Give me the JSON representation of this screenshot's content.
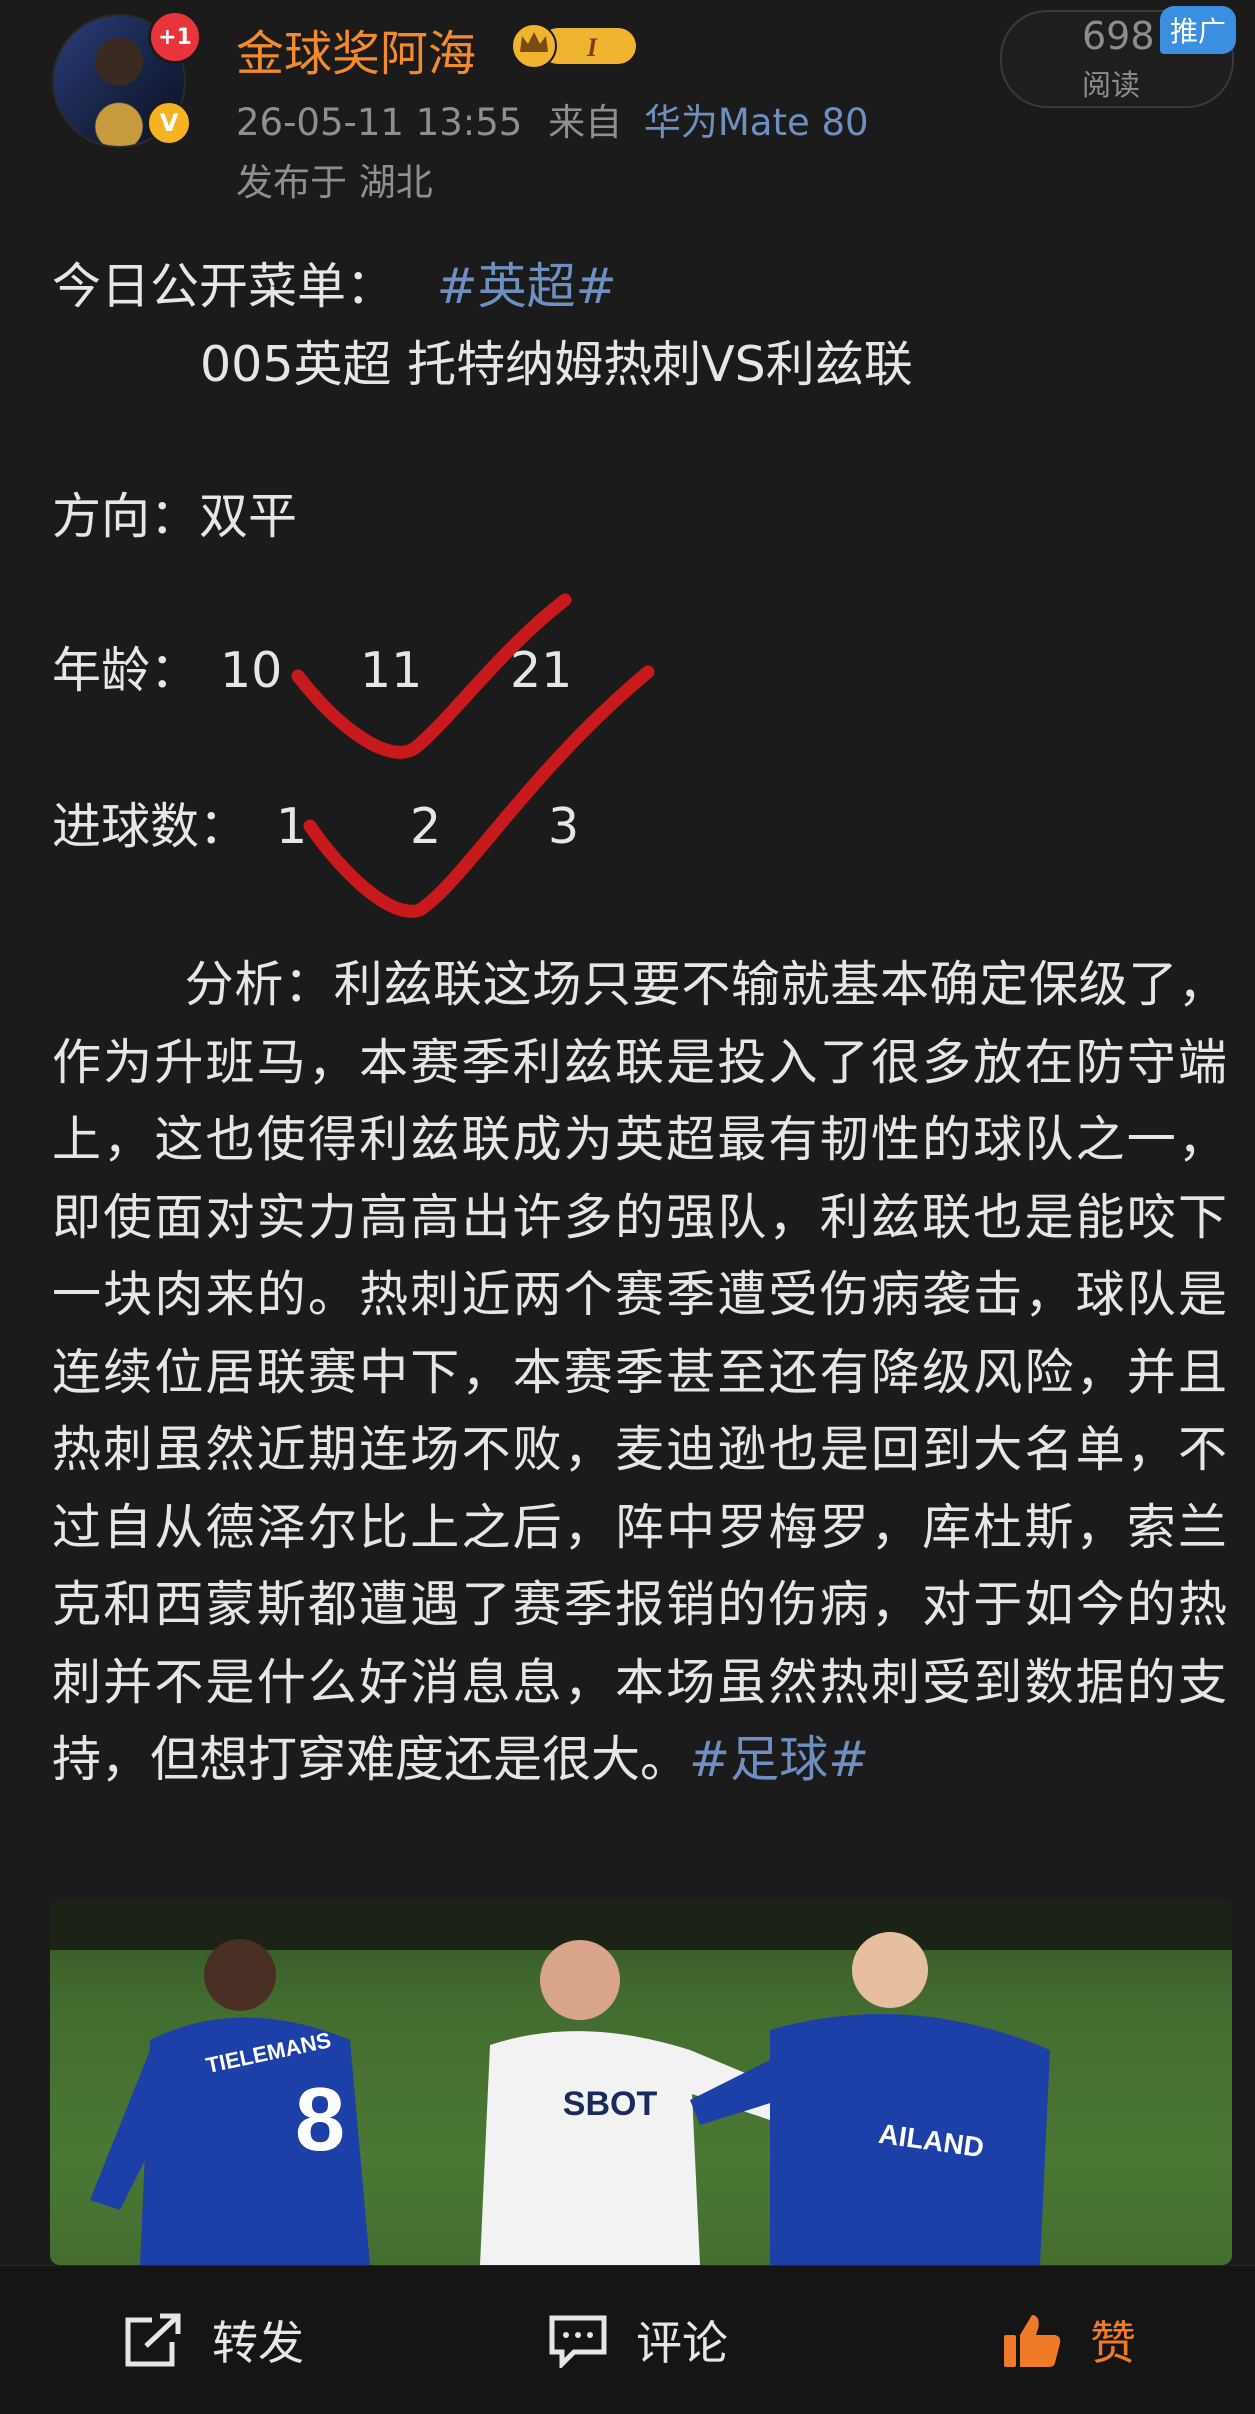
{
  "header": {
    "username": "金球奖阿海",
    "notification_badge": "+1",
    "verified_badge": "V",
    "level_badge": "I",
    "timestamp": "26-05-11 13:55",
    "source_prefix": "来自",
    "device": "华为Mate 80",
    "location": "发布于 湖北",
    "read_count": "698",
    "read_label": "阅读",
    "promo_tag": "推广"
  },
  "post": {
    "menu_label": "今日公开菜单：",
    "topic_tag": "#英超#",
    "match_line": "005英超 托特纳姆热刺VS利兹联",
    "direction_line": "方向：双平",
    "age_label": "年龄：",
    "age_values": [
      "10",
      "11",
      "21"
    ],
    "goals_label": "进球数：",
    "goals_values": [
      "1",
      "2",
      "3"
    ],
    "analysis": "分析：利兹联这场只要不输就基本确定保级了，作为升班马，本赛季利兹联是投入了很多放在防守端上，这也使得利兹联成为英超最有韧性的球队之一，即使面对实力高高出许多的强队，利兹联也是能咬下一块肉来的。热刺近两个赛季遭受伤病袭击，球队是连续位居联赛中下，本赛季甚至还有降级风险，并且热刺虽然近期连场不败，麦迪逊也是回到大名单，不过自从德泽尔比上之后，阵中罗梅罗，库杜斯，索兰克和西蒙斯都遭遇了赛季报销的伤病，对于如今的热刺并不是什么好消息息，本场虽然热刺受到数据的支持，但想打穿难度还是很大。",
    "football_tag": "#足球#"
  },
  "photo": {
    "jersey_number": "8",
    "jersey_name": "TIELEMANS",
    "sponsor_white": "SBOT",
    "sponsor_blue": "AILAND"
  },
  "footer": {
    "repost_label": "转发",
    "comment_label": "评论",
    "like_label": "赞"
  },
  "colors": {
    "background": "#1b1b1b",
    "username": "#f28a2e",
    "link": "#6e8fbf",
    "check_mark": "#c8191d",
    "like_active": "#f07a27"
  }
}
